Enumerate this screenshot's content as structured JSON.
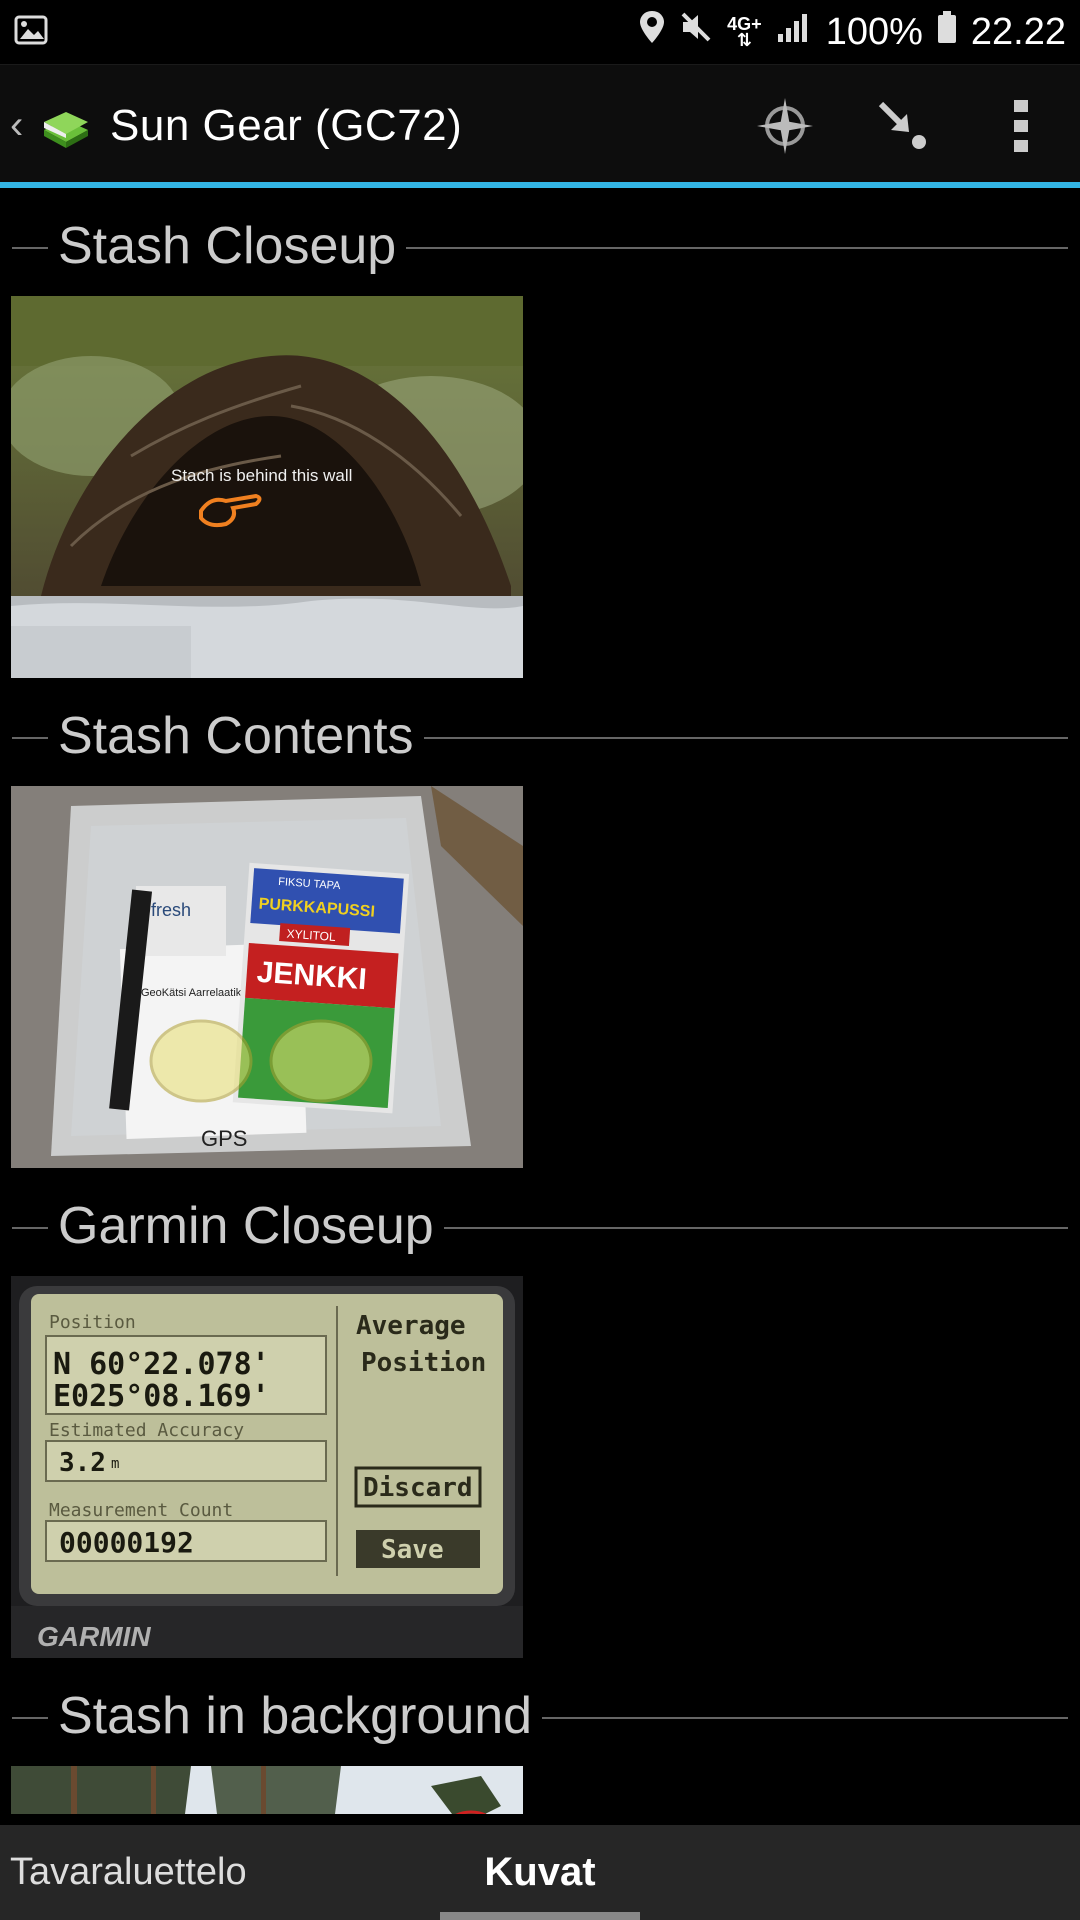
{
  "status_bar": {
    "icons": [
      "image-icon",
      "location-icon",
      "mute-icon",
      "network-4g-icon",
      "signal-icon",
      "battery-icon"
    ],
    "network": "4G+",
    "battery": "100%",
    "time": "22.22"
  },
  "app_bar": {
    "title": "Sun Gear (GC72)",
    "icons": [
      "back-icon",
      "cache-book-icon",
      "compass-icon",
      "navigate-icon",
      "overflow-menu-icon"
    ]
  },
  "sections": [
    {
      "title": "Stash Closeup",
      "overlay_text": "Stach is behind this wall"
    },
    {
      "title": "Stash Contents",
      "product_labels": [
        "FIKSU TAPA",
        "PURKKAPUSSI",
        "XYLITOL",
        "JENKKI",
        "fresh",
        "GeoKätsi Aarrelaatikko",
        "GPS"
      ]
    },
    {
      "title": "Garmin Closeup",
      "gps": {
        "label_position": "Position",
        "lat": "N  60°22.078'",
        "lon": "E025°08.169'",
        "label_accuracy": "Estimated Accuracy",
        "accuracy": "3.2",
        "accuracy_unit": "m",
        "label_count": "Measurement Count",
        "count": "00000192",
        "btn_average": "Average",
        "btn_position": "Position",
        "btn_discard": "Discard",
        "btn_save": "Save",
        "brand": "GARMIN"
      }
    },
    {
      "title": "Stash in background"
    }
  ],
  "tabs": [
    {
      "label": "Tavaraluettelo",
      "active": false
    },
    {
      "label": "Kuvat",
      "active": true
    }
  ],
  "colors": {
    "accent": "#33b5e5",
    "background": "#000000",
    "tab_bar": "#262626"
  }
}
